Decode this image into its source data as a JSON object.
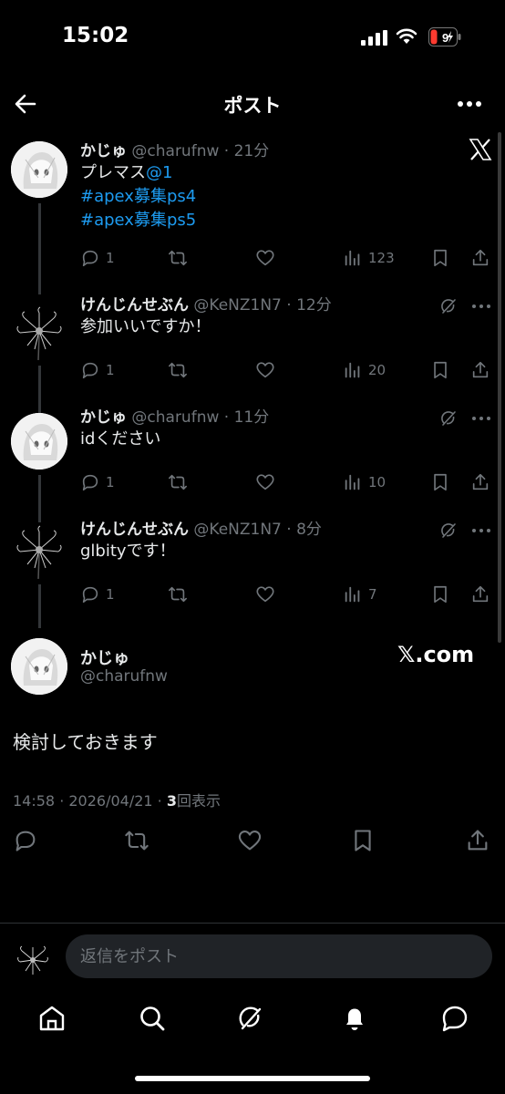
{
  "status": {
    "time": "15:02",
    "battery": "9"
  },
  "header": {
    "title": "ポスト"
  },
  "thread": [
    {
      "name": "かじゅ",
      "handle": "@charufnw",
      "time": "· 21分",
      "lines": [
        {
          "text": "プレマス",
          "link": "@1"
        },
        {
          "text": "",
          "link": " #apex募集ps4"
        },
        {
          "text": "",
          "link": "#apex募集ps5"
        }
      ],
      "replies": "1",
      "views": "123",
      "corner": "x-logo-icon"
    },
    {
      "name": "けんじんせぶん",
      "handle": "@KeNZ1N7",
      "time": "· 12分",
      "lines": [
        {
          "text": "参加いいですか！",
          "link": ""
        }
      ],
      "replies": "1",
      "views": "20",
      "corner": "grok-icon"
    },
    {
      "name": "かじゅ",
      "handle": "@charufnw",
      "time": "· 11分",
      "lines": [
        {
          "text": "idください",
          "link": ""
        }
      ],
      "replies": "1",
      "views": "10",
      "corner": "grok-icon"
    },
    {
      "name": "けんじんせぶん",
      "handle": "@KeNZ1N7",
      "time": "· 8分",
      "lines": [
        {
          "text": "glbityです！",
          "link": ""
        }
      ],
      "replies": "1",
      "views": "7",
      "corner": "grok-icon"
    }
  ],
  "main_post": {
    "name": "かじゅ",
    "handle": "@charufnw",
    "badge": "𝕏.com",
    "text": "検討しておきます",
    "meta_prefix": "14:58 · 2026/04/21 · ",
    "views_count": "3",
    "views_suffix": "回表示"
  },
  "reply_bar": {
    "placeholder": "返信をポスト"
  },
  "tabs": [
    "home-icon",
    "search-icon",
    "grok-icon",
    "notifications-icon",
    "messages-icon"
  ]
}
